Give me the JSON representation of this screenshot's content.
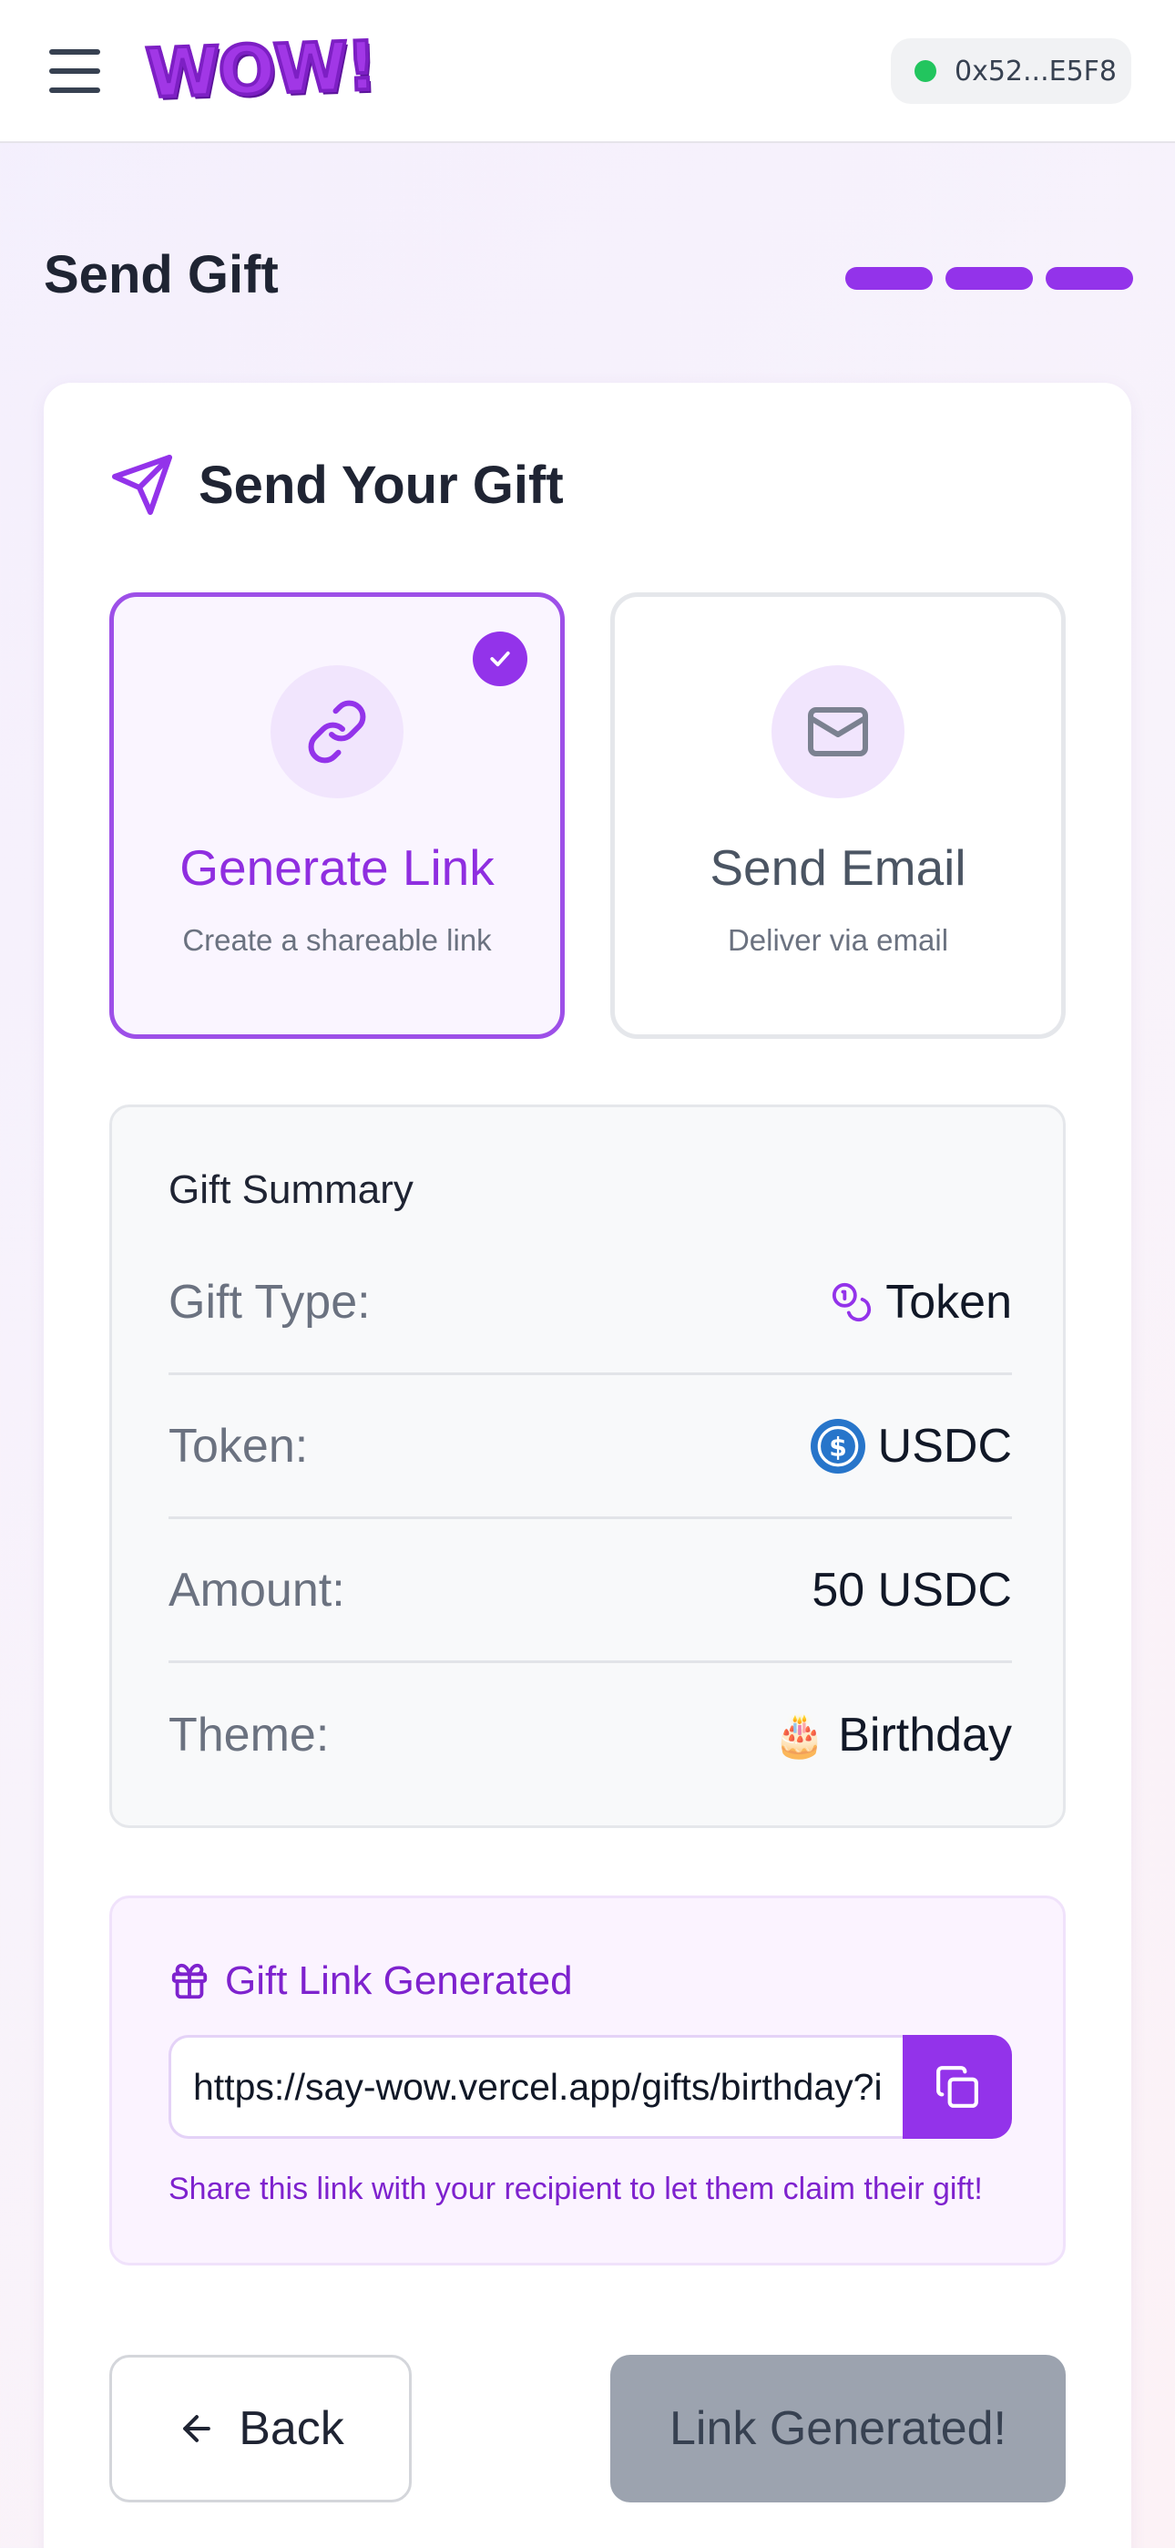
{
  "header": {
    "logo_text": "WOW!",
    "wallet_address": "0x52...E5F8",
    "wallet_status_color": "#22c55e"
  },
  "page": {
    "title": "Send Gift",
    "progress_steps": 3,
    "progress_completed": 3
  },
  "card": {
    "title": "Send Your Gift",
    "icon": "paper-plane-icon"
  },
  "options": [
    {
      "title": "Generate Link",
      "description": "Create a shareable link",
      "icon": "link-icon",
      "selected": true
    },
    {
      "title": "Send Email",
      "description": "Deliver via email",
      "icon": "mail-icon",
      "selected": false
    }
  ],
  "summary": {
    "heading": "Gift Summary",
    "rows": [
      {
        "label": "Gift Type:",
        "value": "Token",
        "icon": "coins-icon"
      },
      {
        "label": "Token:",
        "value": "USDC",
        "icon": "usdc-icon"
      },
      {
        "label": "Amount:",
        "value": "50 USDC"
      },
      {
        "label": "Theme:",
        "value": "Birthday",
        "icon": "birthday-icon"
      }
    ]
  },
  "link_panel": {
    "heading": "Gift Link Generated",
    "url": "https://say-wow.vercel.app/gifts/birthday?i",
    "help": "Share this link with your recipient to let them claim their gift!",
    "copy_icon": "copy-icon"
  },
  "actions": {
    "back_label": "Back",
    "primary_label": "Link Generated!"
  },
  "colors": {
    "accent": "#9333ea",
    "accent_text": "#7e22ce",
    "disabled_button": "#9ca3af"
  }
}
